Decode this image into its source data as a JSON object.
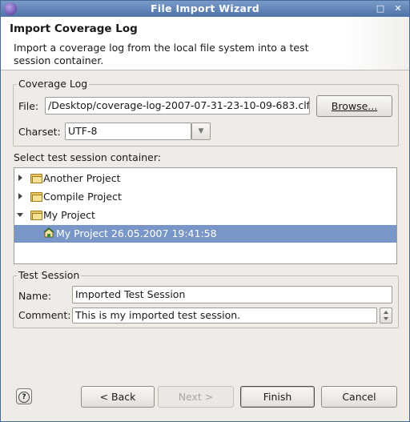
{
  "window": {
    "title": "File Import Wizard"
  },
  "header": {
    "title": "Import Coverage Log",
    "description": "Import a coverage log from the local file system into a test session container."
  },
  "coverage_log": {
    "group_label": "Coverage Log",
    "file_label": "File:",
    "file_value": "/Desktop/coverage-log-2007-07-31-23-10-09-683.clf",
    "browse_label": "Browse...",
    "charset_label": "Charset:",
    "charset_value": "UTF-8"
  },
  "container": {
    "label": "Select test session container:",
    "items": [
      {
        "label": "Another Project",
        "expanded": false,
        "selected": false
      },
      {
        "label": "Compile Project",
        "expanded": false,
        "selected": false
      },
      {
        "label": "My Project",
        "expanded": true,
        "selected": false
      },
      {
        "label": "My Project 26.05.2007 19:41:58",
        "child": true,
        "selected": true
      }
    ]
  },
  "test_session": {
    "group_label": "Test Session",
    "name_label": "Name:",
    "name_value": "Imported Test Session",
    "comment_label": "Comment:",
    "comment_value": "This is my imported test session."
  },
  "buttons": {
    "back": "< Back",
    "next": "Next >",
    "finish": "Finish",
    "cancel": "Cancel",
    "help": "?"
  }
}
